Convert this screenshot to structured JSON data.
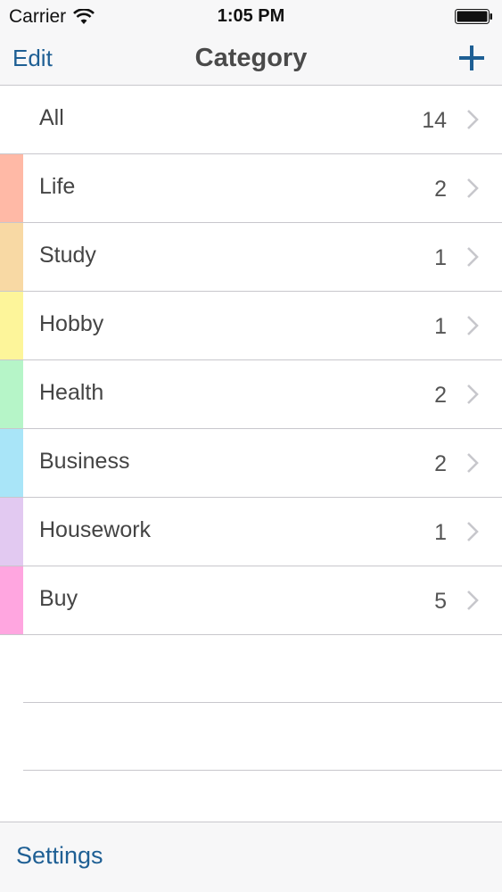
{
  "status_bar": {
    "carrier": "Carrier",
    "time": "1:05 PM",
    "wifi_icon": "wifi-icon",
    "battery_icon": "battery-icon"
  },
  "nav": {
    "edit_label": "Edit",
    "title": "Category",
    "add_icon": "plus-icon"
  },
  "categories": [
    {
      "label": "All",
      "count": "14",
      "color": ""
    },
    {
      "label": "Life",
      "count": "2",
      "color": "#ffb9a6"
    },
    {
      "label": "Study",
      "count": "1",
      "color": "#f8d9a4"
    },
    {
      "label": "Hobby",
      "count": "1",
      "color": "#fdf59a"
    },
    {
      "label": "Health",
      "count": "2",
      "color": "#b6f5c8"
    },
    {
      "label": "Business",
      "count": "2",
      "color": "#a9e5f8"
    },
    {
      "label": "Housework",
      "count": "1",
      "color": "#e2c9f1"
    },
    {
      "label": "Buy",
      "count": "5",
      "color": "#ffa6e0"
    }
  ],
  "toolbar": {
    "settings_label": "Settings"
  },
  "colors": {
    "accent": "#1e5f94",
    "separator": "#c8c7cc",
    "bar_background": "#f7f7f8"
  }
}
